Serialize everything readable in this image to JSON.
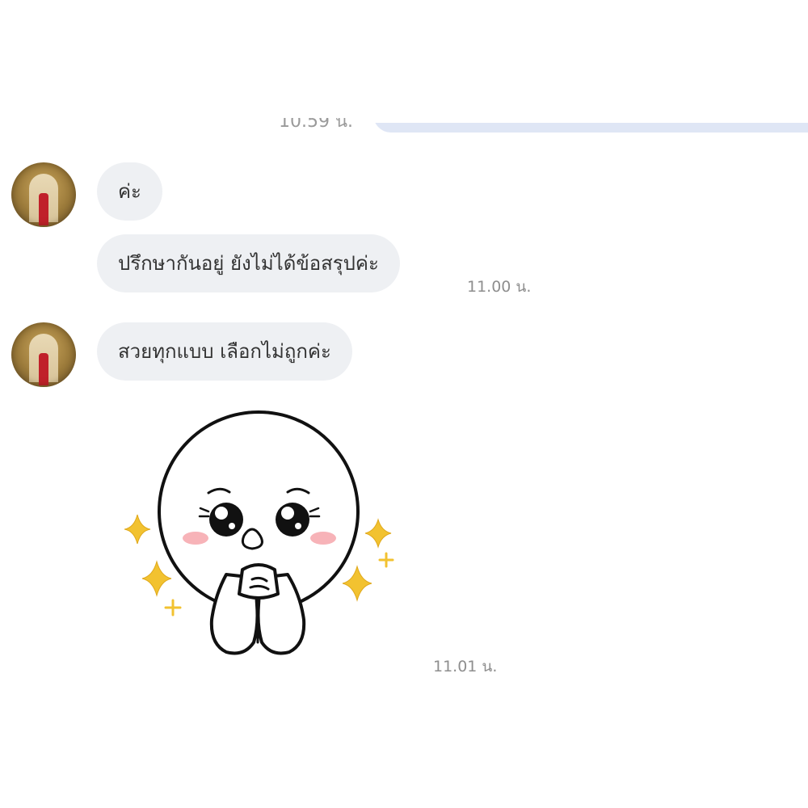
{
  "previous_message": {
    "time": "10.59 น."
  },
  "messages": [
    {
      "text": "ค่ะ"
    },
    {
      "text": "ปรึกษากันอยู่ ยังไม่ได้ข้อสรุปค่ะ",
      "time": "11.00 น."
    },
    {
      "text": "สวยทุกแบบ เลือกไม่ถูกค่ะ"
    },
    {
      "sticker": "sticker-pleading-face-icon",
      "time": "11.01 น."
    }
  ],
  "colors": {
    "incoming_bubble": "#eef0f3",
    "outgoing_bubble": "#dfe6f5",
    "timestamp": "#8e8e8e",
    "sparkle": "#f2c230"
  }
}
